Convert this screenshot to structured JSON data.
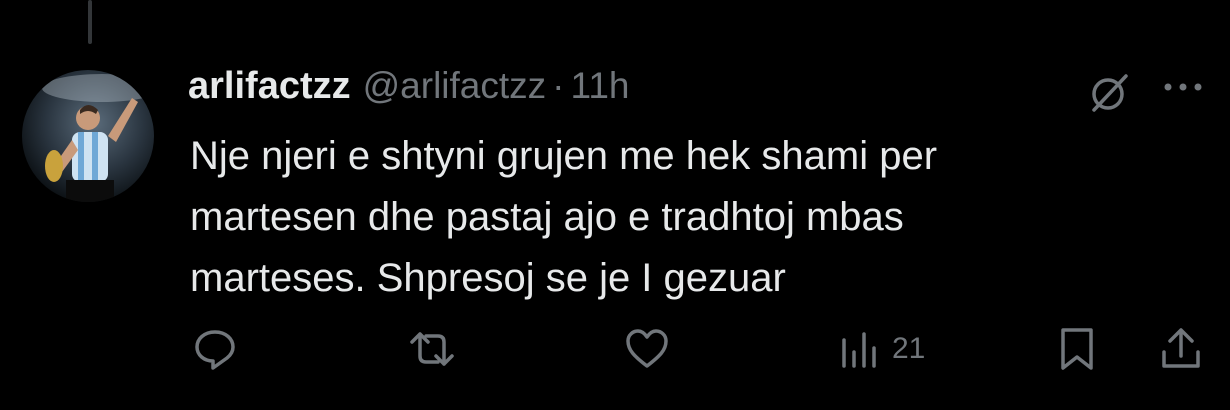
{
  "tweet": {
    "author_name": "arlifactzz",
    "author_handle": "@arlifactzz",
    "separator": "·",
    "time": "11h",
    "text": "Nje njeri e shtyni grujen me hek shami per\nmartesen dhe pastaj ajo e tradhtoj mbas\nmarteses. Shpresoj se je I gezuar"
  },
  "stats": {
    "views": "21"
  },
  "icons": {
    "reply": "reply-icon",
    "retweet": "retweet-icon",
    "like": "like-icon",
    "views": "views-icon",
    "bookmark": "bookmark-icon",
    "share": "share-icon",
    "grok": "grok-icon",
    "more": "more-icon"
  },
  "colors": {
    "background": "#000000",
    "text_primary": "#e7e9ea",
    "text_secondary": "#71767b"
  }
}
